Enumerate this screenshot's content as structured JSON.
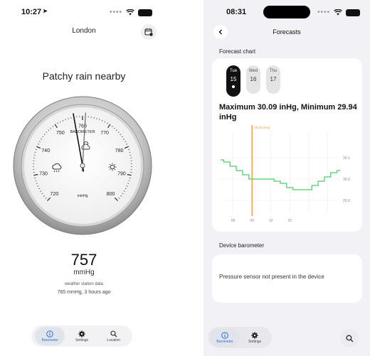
{
  "left": {
    "status_time": "10:27",
    "city": "London",
    "weather": "Patchy rain nearby",
    "gauge": {
      "brand": "BAROMETER",
      "unit": "mmHg",
      "tick_labels": [
        "720",
        "730",
        "740",
        "750",
        "760",
        "770",
        "780",
        "790",
        "800"
      ],
      "min": 720,
      "max": 800,
      "needle_value": 757,
      "reference_value": 761
    },
    "reading": "757",
    "reading_unit": "mmHg",
    "source": "weather station data",
    "sub": "765 mmHg, 3 hours ago",
    "tabs": [
      {
        "label": "Barometer",
        "icon": "info-icon",
        "active": true
      },
      {
        "label": "Settings",
        "icon": "gear-icon",
        "active": false
      },
      {
        "label": "Location",
        "icon": "search-icon",
        "active": false
      }
    ]
  },
  "right": {
    "status_time": "08:31",
    "title": "Forecasts",
    "forecast_label": "Forecast chart",
    "days": [
      {
        "name": "Tue",
        "date": "15",
        "active": true
      },
      {
        "name": "Wed",
        "date": "16",
        "active": false
      },
      {
        "name": "Thu",
        "date": "17",
        "active": false
      }
    ],
    "summary": "Maximum 30.09 inHg, Minimum 29.94 inHg",
    "device_label": "Device barometer",
    "no_sensor": "Pressure sensor not present in the device",
    "tabs": [
      {
        "label": "Barometer",
        "icon": "info-icon",
        "active": true
      },
      {
        "label": "Settings",
        "icon": "gear-icon",
        "active": false
      }
    ],
    "colors": {
      "accent": "#2f6fde",
      "line": "#4cc96a",
      "marker": "#f0a030"
    }
  },
  "chart_data": {
    "type": "line",
    "title": "",
    "xlabel": "",
    "ylabel": "",
    "x": [
      4,
      5,
      6,
      7,
      8,
      9,
      10,
      11,
      12,
      13,
      14,
      15,
      16,
      17,
      18,
      19,
      20,
      21,
      22,
      23
    ],
    "x_ticks": [
      "06",
      "09",
      "12",
      "15"
    ],
    "x_tick_values": [
      6,
      9,
      12,
      15
    ],
    "y_ticks": [
      "30.1",
      "30.0",
      "29.9"
    ],
    "y_tick_values": [
      30.1,
      30.0,
      29.9
    ],
    "ylim": [
      29.84,
      30.2
    ],
    "series": [
      {
        "values": [
          30.09,
          30.08,
          30.06,
          30.04,
          30.02,
          30.0,
          30.0,
          30.0,
          30.0,
          29.99,
          29.98,
          29.96,
          29.95,
          29.95,
          29.95,
          29.97,
          29.99,
          30.01,
          30.03,
          30.04
        ]
      }
    ],
    "marker": {
      "x": 9,
      "label": "30.03 inHg"
    },
    "grid": true
  }
}
